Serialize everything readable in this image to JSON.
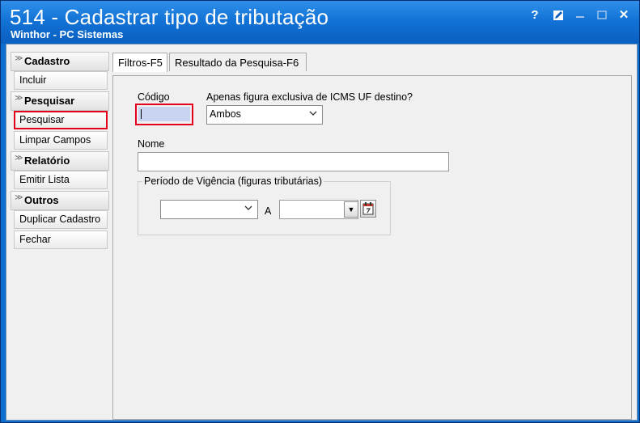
{
  "window": {
    "title": "514 - Cadastrar tipo de tributação",
    "subtitle": "Winthor - PC Sistemas",
    "help_glyph": "?",
    "close_glyph": "✕"
  },
  "sidebar": {
    "groups": [
      {
        "label": "Cadastro",
        "items": [
          {
            "label": "Incluir"
          }
        ]
      },
      {
        "label": "Pesquisar",
        "items": [
          {
            "label": "Pesquisar"
          },
          {
            "label": "Limpar Campos"
          }
        ]
      },
      {
        "label": "Relatório",
        "items": [
          {
            "label": "Emitir Lista"
          }
        ]
      },
      {
        "label": "Outros",
        "items": [
          {
            "label": "Duplicar Cadastro"
          },
          {
            "label": "Fechar"
          }
        ]
      }
    ]
  },
  "tabs": [
    {
      "label": "Filtros-F5",
      "active": true
    },
    {
      "label": "Resultado da Pesquisa-F6",
      "active": false
    }
  ],
  "form": {
    "codigo_label": "Código",
    "codigo_value": "",
    "icms_label": "Apenas figura exclusiva de ICMS UF destino?",
    "icms_value": "Ambos",
    "nome_label": "Nome",
    "nome_value": "",
    "vigencia_title": "Período de Vigência (figuras tributárias)",
    "vigencia_from": "",
    "vigencia_sep": "A",
    "vigencia_to": ""
  },
  "colors": {
    "title_bar": "#1273d6",
    "highlight": "#e2001a",
    "focused_input": "#c8d4f0"
  }
}
